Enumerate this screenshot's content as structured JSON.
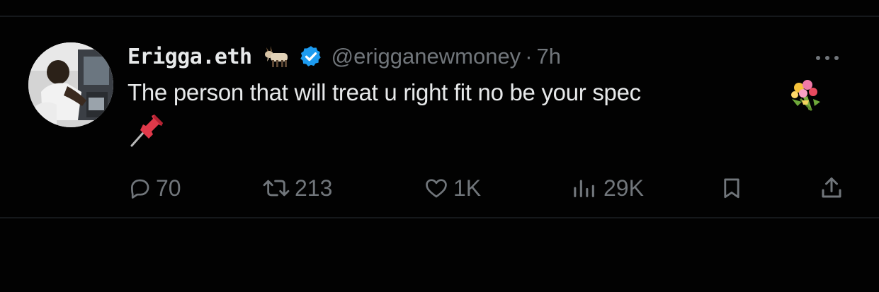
{
  "tweet": {
    "display_name": "Erigga.eth",
    "handle": "@erigganewmoney",
    "separator": "·",
    "timestamp": "7h",
    "text": "The person that will treat u right fit no be your spec",
    "emoji_after_name": "goat",
    "emoji_inline": "bouquet",
    "emoji_second_line": "pushpin",
    "verified": true
  },
  "actions": {
    "replies": "70",
    "retweets": "213",
    "likes": "1K",
    "views": "29K"
  },
  "colors": {
    "background": "#020202",
    "primary_text": "#e7e9ea",
    "secondary_text": "#71767b",
    "verified_badge": "#1d9bf0",
    "divider": "#15181b"
  },
  "icons": [
    "goat-emoji-icon",
    "verified-badge-icon",
    "more-options-icon",
    "bouquet-emoji-icon",
    "pushpin-emoji-icon",
    "reply-icon",
    "retweet-icon",
    "like-icon",
    "views-icon",
    "bookmark-icon",
    "share-icon"
  ]
}
